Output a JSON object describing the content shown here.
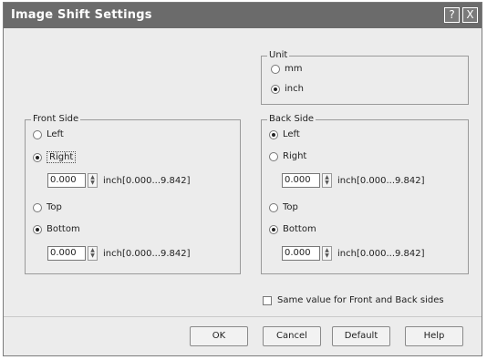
{
  "window": {
    "title": "Image Shift Settings",
    "help_glyph": "?",
    "close_glyph": "X"
  },
  "unit": {
    "legend": "Unit",
    "options": [
      {
        "label": "mm",
        "selected": false
      },
      {
        "label": "inch",
        "selected": true
      }
    ]
  },
  "front": {
    "legend": "Front Side",
    "horizontal": [
      {
        "label": "Left",
        "selected": false
      },
      {
        "label": "Right",
        "selected": true
      }
    ],
    "h_value": "0.000",
    "h_range": "inch[0.000...9.842]",
    "vertical": [
      {
        "label": "Top",
        "selected": false
      },
      {
        "label": "Bottom",
        "selected": true
      }
    ],
    "v_value": "0.000",
    "v_range": "inch[0.000...9.842]"
  },
  "back": {
    "legend": "Back Side",
    "horizontal": [
      {
        "label": "Left",
        "selected": true
      },
      {
        "label": "Right",
        "selected": false
      }
    ],
    "h_value": "0.000",
    "h_range": "inch[0.000...9.842]",
    "vertical": [
      {
        "label": "Top",
        "selected": false
      },
      {
        "label": "Bottom",
        "selected": true
      }
    ],
    "v_value": "0.000",
    "v_range": "inch[0.000...9.842]"
  },
  "same_value": {
    "label": "Same value for Front and Back sides",
    "checked": false
  },
  "buttons": {
    "ok": "OK",
    "cancel": "Cancel",
    "default": "Default",
    "help": "Help"
  }
}
